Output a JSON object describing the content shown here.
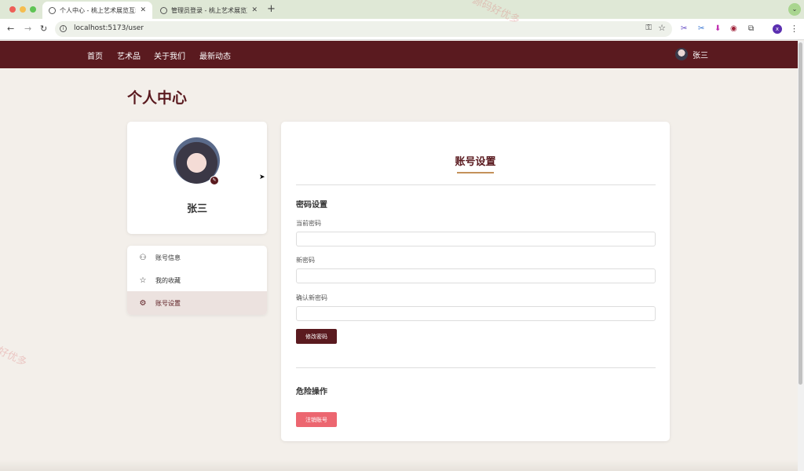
{
  "browser": {
    "tabs": [
      {
        "title": "个人中心 - 桃上艺术展览互动平",
        "active": true
      },
      {
        "title": "管理员登录 - 桃上艺术展览互动",
        "active": false
      }
    ],
    "url": "localhost:5173/user",
    "profile_initial": "x"
  },
  "site": {
    "nav": [
      "首页",
      "艺术品",
      "关于我们",
      "最新动态"
    ],
    "user": "张三",
    "watermark": "源码好优多"
  },
  "page": {
    "title": "个人中心"
  },
  "profile": {
    "name": "张三"
  },
  "menu": [
    {
      "label": "账号信息",
      "icon": "user-icon",
      "active": false
    },
    {
      "label": "我的收藏",
      "icon": "star-icon",
      "active": false
    },
    {
      "label": "账号设置",
      "icon": "gear-icon",
      "active": true
    }
  ],
  "settings": {
    "title": "账号设置",
    "password_section": "密码设置",
    "current_label": "当前密码",
    "current_value": "",
    "new_label": "新密码",
    "new_value": "",
    "confirm_label": "确认新密码",
    "confirm_value": "",
    "change_button": "修改密码",
    "danger_section": "危险操作",
    "delete_button": "注销账号"
  },
  "colors": {
    "brand": "#5a1a1f",
    "accent": "#c4915a",
    "danger": "#ec6670",
    "background": "#f3efea"
  }
}
